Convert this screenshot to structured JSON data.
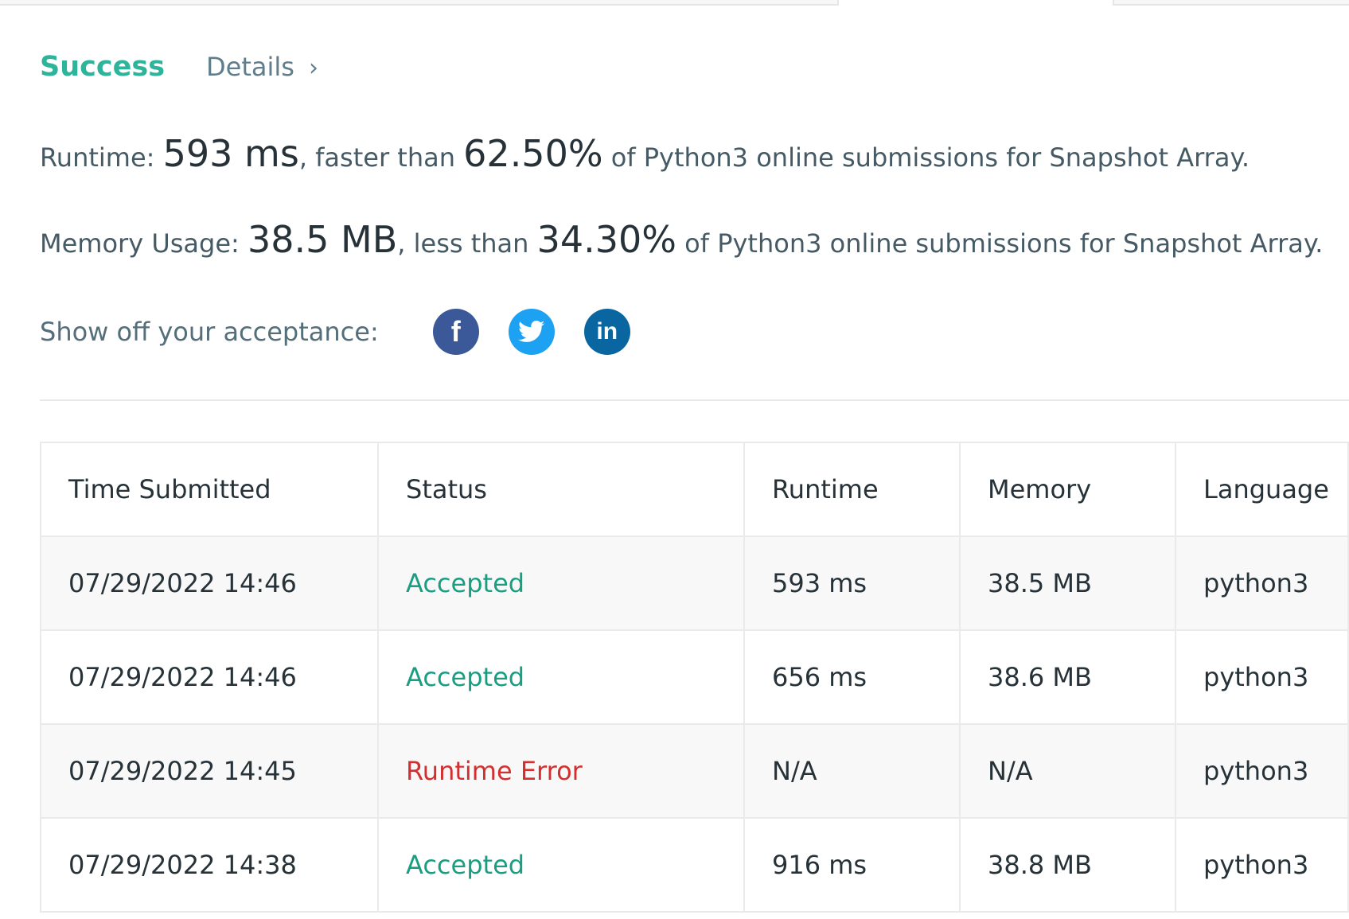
{
  "header": {
    "result_label": "Success",
    "details_label": "Details",
    "details_chevron": "›"
  },
  "runtime_line": {
    "prefix": "Runtime: ",
    "value": "593 ms",
    "mid": ", faster than ",
    "percent": "62.50%",
    "suffix": " of Python3 online submissions for Snapshot Array."
  },
  "memory_line": {
    "prefix": "Memory Usage: ",
    "value": "38.5 MB",
    "mid": ", less than ",
    "percent": "34.30%",
    "suffix": " of Python3 online submissions for Snapshot Array."
  },
  "share": {
    "label": "Show off your acceptance:",
    "icons": [
      "facebook-icon",
      "twitter-icon",
      "linkedin-icon"
    ],
    "facebook_glyph": "f",
    "linkedin_glyph": "in"
  },
  "table": {
    "headers": [
      "Time Submitted",
      "Status",
      "Runtime",
      "Memory",
      "Language"
    ],
    "rows": [
      {
        "time": "07/29/2022 14:46",
        "status": "Accepted",
        "runtime": "593 ms",
        "memory": "38.5 MB",
        "language": "python3"
      },
      {
        "time": "07/29/2022 14:46",
        "status": "Accepted",
        "runtime": "656 ms",
        "memory": "38.6 MB",
        "language": "python3"
      },
      {
        "time": "07/29/2022 14:45",
        "status": "Runtime Error",
        "runtime": "N/A",
        "memory": "N/A",
        "language": "python3"
      },
      {
        "time": "07/29/2022 14:38",
        "status": "Accepted",
        "runtime": "916 ms",
        "memory": "38.8 MB",
        "language": "python3"
      }
    ]
  },
  "colors": {
    "success": "#2db59b",
    "accepted": "#1a9e82",
    "runtime_error": "#d32f2f",
    "facebook": "#3b5998",
    "twitter": "#1da1f2",
    "linkedin": "#0a66a0"
  }
}
